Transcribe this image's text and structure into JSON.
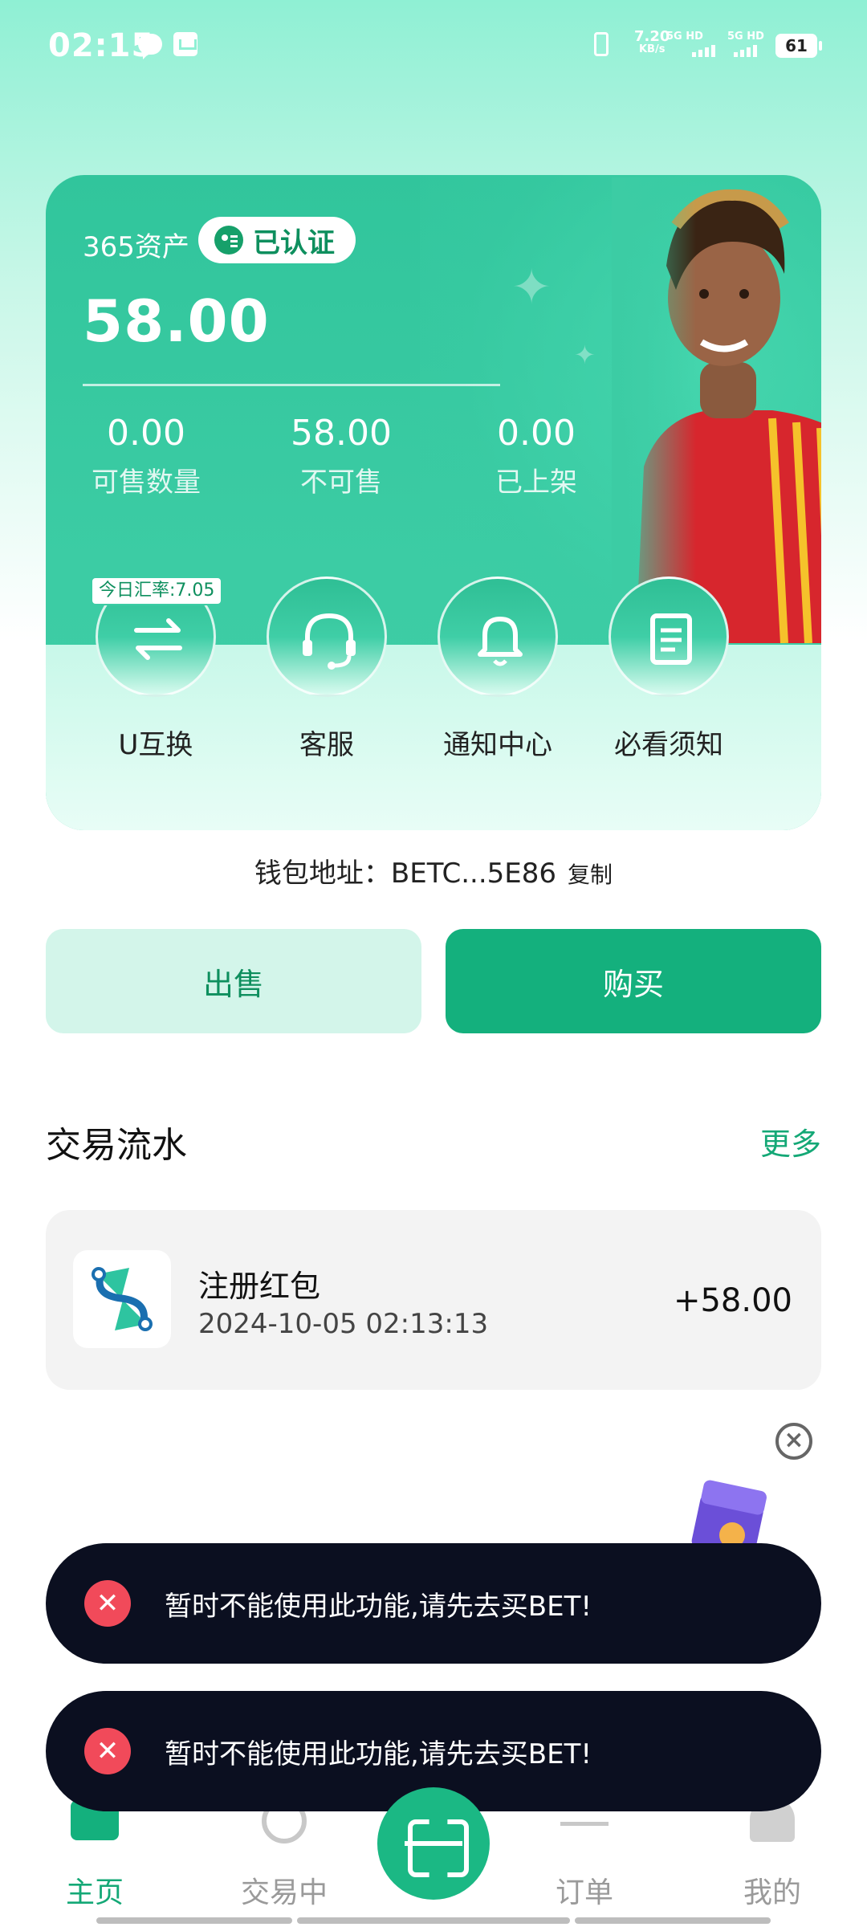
{
  "status_bar": {
    "time": "02:15",
    "net_speed": "7.20",
    "net_unit": "KB/s",
    "sim1": "5G HD",
    "sim2": "5G HD",
    "battery": "61"
  },
  "asset_card": {
    "label": "365资产",
    "verified_label": "已认证",
    "total": "58.00",
    "stats": [
      {
        "value": "0.00",
        "label": "可售数量"
      },
      {
        "value": "58.00",
        "label": "不可售"
      },
      {
        "value": "0.00",
        "label": "已上架"
      }
    ],
    "rate_tag": "今日汇率:7.05",
    "actions": [
      {
        "label": "U互换",
        "icon": "swap-icon"
      },
      {
        "label": "客服",
        "icon": "headset-icon"
      },
      {
        "label": "通知中心",
        "icon": "bell-icon"
      },
      {
        "label": "必看须知",
        "icon": "notebook-icon"
      }
    ]
  },
  "wallet": {
    "label": "钱包地址：",
    "address": "BETC...5E86",
    "copy_label": "复制"
  },
  "buttons": {
    "sell": "出售",
    "buy": "购买"
  },
  "transactions": {
    "title": "交易流水",
    "more": "更多",
    "items": [
      {
        "name": "注册红包",
        "time": "2024-10-05 02:13:13",
        "amount": "+58.00"
      }
    ]
  },
  "toasts": [
    {
      "text": "暂时不能使用此功能,请先去买BET!"
    },
    {
      "text": "暂时不能使用此功能,请先去买BET!"
    }
  ],
  "nav": {
    "items": [
      {
        "label": "主页",
        "active": true
      },
      {
        "label": "交易中",
        "active": false
      },
      {
        "label": "订单",
        "active": false
      },
      {
        "label": "我的",
        "active": false
      }
    ]
  },
  "colors": {
    "accent": "#14b07d",
    "card": "#3ccca4",
    "toast_bg": "#0b0f20",
    "error": "#f14a5a"
  }
}
